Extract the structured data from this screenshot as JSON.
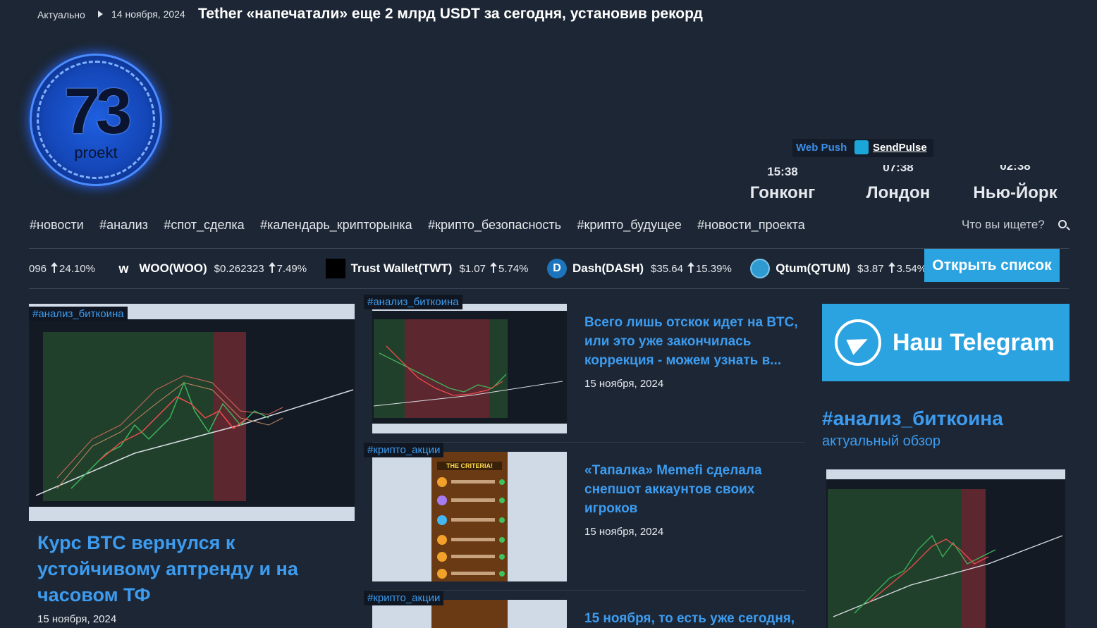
{
  "topbar": {
    "label": "Актуально",
    "date": "14 ноября, 2024",
    "headline": "Tether «напечатали» еще 2 млрд USDT за сегодня, установив рекорд"
  },
  "logo": {
    "number": "73",
    "subtitle": "proekt"
  },
  "webpush": {
    "label": "Web Push",
    "brand": "SendPulse"
  },
  "clocks": [
    {
      "time": "15:38",
      "city": "Гонконг"
    },
    {
      "time": "07:38",
      "city": "Лондон"
    },
    {
      "time": "02:38",
      "city": "Нью-Йорк"
    }
  ],
  "nav": [
    "#новости",
    "#анализ",
    "#спот_сделка",
    "#календарь_крипторынка",
    "#крипто_безопасность",
    "#крипто_будущее",
    "#новости_проекта"
  ],
  "search": {
    "placeholder": "Что вы ищете?"
  },
  "ticker": [
    {
      "name": "",
      "price": "096",
      "change": "24.10%",
      "icon": "none",
      "color": "#1c2634"
    },
    {
      "name": "WOO(WOO)",
      "price": "$0.262323",
      "change": "7.49%",
      "icon": "woo-icon",
      "color": "#1c2634"
    },
    {
      "name": "Trust Wallet(TWT)",
      "price": "$1.07",
      "change": "5.74%",
      "icon": "twt-icon",
      "color": "#000000"
    },
    {
      "name": "Dash(DASH)",
      "price": "$35.64",
      "change": "15.39%",
      "icon": "dash-icon",
      "color": "#1c75bc"
    },
    {
      "name": "Qtum(QTUM)",
      "price": "$3.87",
      "change": "3.54%",
      "icon": "qtum-icon",
      "color": "#2e9ad0"
    }
  ],
  "open_list": "Открыть список",
  "main_article": {
    "tag": "#анализ_биткоина",
    "title": "Курс BTC вернулся к устойчивому аптренду и на часовом ТФ",
    "date": "15 ноября, 2024"
  },
  "articles": [
    {
      "tag": "#анализ_биткоина",
      "title": "Всего лишь отскок идет на BTC, или это уже закончилась коррекция - можем узнать в...",
      "date": "15 ноября, 2024"
    },
    {
      "tag": "#крипто_акции",
      "title": "«Тапалка» Memefi сделала снепшот аккаунтов своих игроков",
      "date": "15 ноября, 2024",
      "card_header": "THE CRITERIA!"
    },
    {
      "tag": "#крипто_акции",
      "title": "15 ноября, то есть уже сегодня,",
      "date": ""
    }
  ],
  "telegram": {
    "label": "Наш Telegram"
  },
  "sidebar": {
    "heading": "#анализ_биткоина",
    "subheading": "актуальный обзор"
  },
  "colors": {
    "accent": "#3d9cf0",
    "button": "#2aa3e0",
    "background": "#1c2634"
  }
}
